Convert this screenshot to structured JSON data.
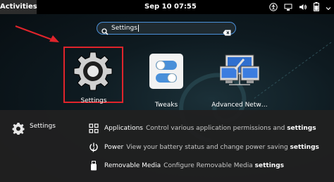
{
  "topbar": {
    "activities_label": "Activities",
    "clock": "Sep 10  07:55",
    "tray_icons": [
      "accessibility-icon",
      "network-icon",
      "volume-icon",
      "battery-icon",
      "system-menu-icon"
    ]
  },
  "search": {
    "value": "Settings",
    "icon": "search-icon",
    "clear_icon": "clear-icon"
  },
  "apps": [
    {
      "label": "Settings",
      "icon": "gear-icon",
      "highlighted": true,
      "highlight_color": "#e0242b"
    },
    {
      "label": "Tweaks",
      "icon": "tweaks-toggle-icon"
    },
    {
      "label": "Advanced Netw…",
      "icon": "network-computers-icon"
    }
  ],
  "annotation_arrow_color": "#e0242b",
  "results": {
    "provider": {
      "name": "Settings",
      "icon": "gear-icon"
    },
    "items": [
      {
        "icon": "applications-grid-icon",
        "title": "Applications",
        "desc_before": "Control various application permissions and ",
        "desc_bold": "settings"
      },
      {
        "icon": "power-icon",
        "title": "Power",
        "desc_before": "View your battery status and change power saving ",
        "desc_bold": "settings"
      },
      {
        "icon": "usb-icon",
        "title": "Removable Media",
        "desc_before": "Configure Removable Media ",
        "desc_bold": "settings"
      }
    ]
  },
  "colors": {
    "accent": "#4a90d9",
    "annotation": "#e0242b",
    "panel": "#202020"
  }
}
